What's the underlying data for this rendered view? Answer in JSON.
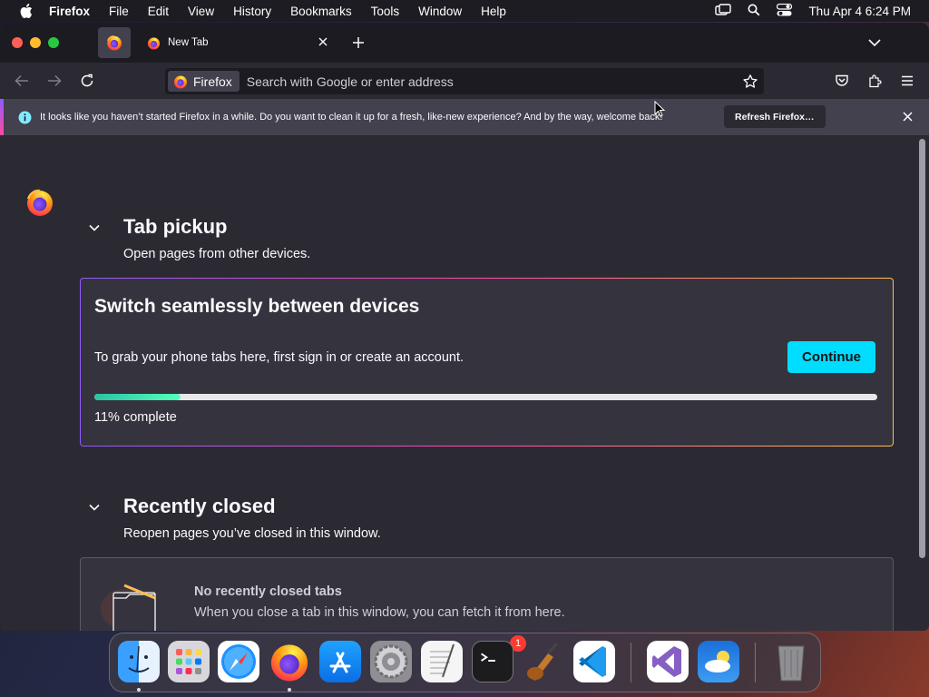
{
  "menubar": {
    "app_name": "Firefox",
    "items": [
      "File",
      "Edit",
      "View",
      "History",
      "Bookmarks",
      "Tools",
      "Window",
      "Help"
    ],
    "datetime": "Thu Apr 4  6:24 PM"
  },
  "tabs": {
    "active_title": "New Tab"
  },
  "urlbar": {
    "identity_label": "Firefox",
    "placeholder": "Search with Google or enter address"
  },
  "notification": {
    "message": "It looks like you haven’t started Firefox in a while. Do you want to clean it up for a fresh, like-new experience? And by the way, welcome back!",
    "button": "Refresh Firefox…"
  },
  "tab_pickup": {
    "heading": "Tab pickup",
    "subtitle": "Open pages from other devices.",
    "card_title": "Switch seamlessly between devices",
    "card_desc": "To grab your phone tabs here, first sign in or create an account.",
    "button": "Continue",
    "progress_fraction": 0.11,
    "progress_label": "11% complete"
  },
  "recently_closed": {
    "heading": "Recently closed",
    "subtitle": "Reopen pages you’ve closed in this window.",
    "empty_title": "No recently closed tabs",
    "empty_desc": "When you close a tab in this window, you can fetch it from here."
  },
  "dock": {
    "apps": [
      "finder",
      "launchpad",
      "safari",
      "firefox",
      "app-store",
      "system-settings",
      "textedit",
      "terminal",
      "garageband",
      "vscode",
      "visual-studio",
      "weather",
      "trash"
    ],
    "settings_badge": "1"
  },
  "colors": {
    "accent": "#00ddff",
    "content_bg": "#2b2a33",
    "progress": "#2ac3a2"
  }
}
